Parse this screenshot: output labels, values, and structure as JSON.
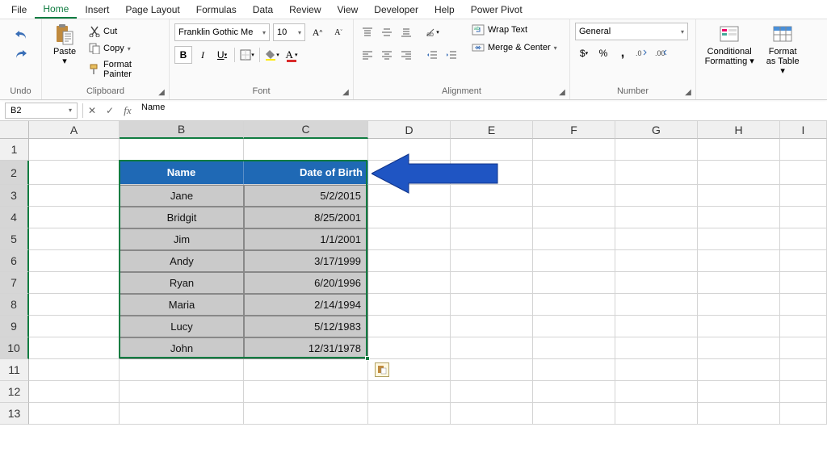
{
  "menu": {
    "items": [
      "File",
      "Home",
      "Insert",
      "Page Layout",
      "Formulas",
      "Data",
      "Review",
      "View",
      "Developer",
      "Help",
      "Power Pivot"
    ],
    "active": "Home"
  },
  "ribbon": {
    "undo_label": "Undo",
    "paste_label": "Paste",
    "cut_label": "Cut",
    "copy_label": "Copy",
    "fmtpainter_label": "Format Painter",
    "clipboard_label": "Clipboard",
    "font_name": "Franklin Gothic Me",
    "font_size": "10",
    "font_label": "Font",
    "align_label": "Alignment",
    "wrap_label": "Wrap Text",
    "merge_label": "Merge & Center",
    "number_format": "General",
    "number_label": "Number",
    "condfmt_label": "Conditional Formatting",
    "tablefmt_label": "Format as Table"
  },
  "namebox": "B2",
  "formula": "Name",
  "columns": [
    "A",
    "B",
    "C",
    "D",
    "E",
    "F",
    "G",
    "H",
    "I"
  ],
  "rows": [
    "1",
    "2",
    "3",
    "4",
    "5",
    "6",
    "7",
    "8",
    "9",
    "10",
    "11",
    "12",
    "13"
  ],
  "table": {
    "headers": {
      "name": "Name",
      "dob": "Date of Birth"
    },
    "rows": [
      {
        "name": "Jane",
        "dob": "5/2/2015"
      },
      {
        "name": "Bridgit",
        "dob": "8/25/2001"
      },
      {
        "name": "Jim",
        "dob": "1/1/2001"
      },
      {
        "name": "Andy",
        "dob": "3/17/1999"
      },
      {
        "name": "Ryan",
        "dob": "6/20/1996"
      },
      {
        "name": "Maria",
        "dob": "2/14/1994"
      },
      {
        "name": "Lucy",
        "dob": "5/12/1983"
      },
      {
        "name": "John",
        "dob": "12/31/1978"
      }
    ]
  }
}
